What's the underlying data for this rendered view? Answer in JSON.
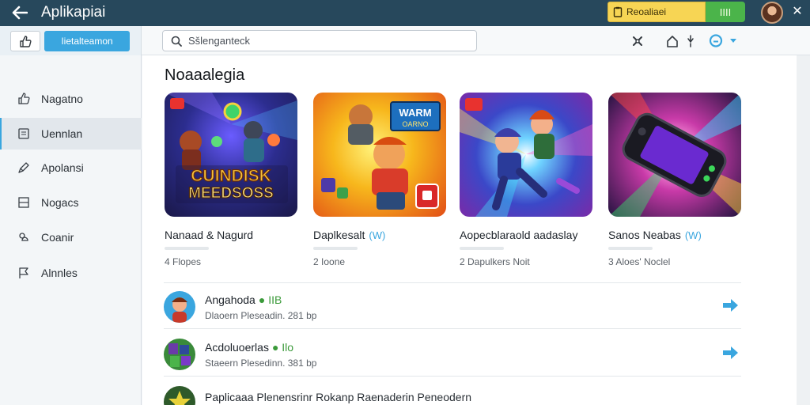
{
  "titlebar": {
    "title": "Aplikapiai",
    "promo_label": "Reoaliaei",
    "promo_count": "IIII"
  },
  "toolbar": {
    "primary_button": "Iietalteamon",
    "search_placeholder": "Sšlenganteck"
  },
  "sidebar": {
    "items": [
      {
        "label": "Nagatno",
        "icon": "thumbs-up-icon"
      },
      {
        "label": "Uennlan",
        "icon": "document-icon",
        "active": true
      },
      {
        "label": "Apolansi",
        "icon": "pen-icon"
      },
      {
        "label": "Nogacs",
        "icon": "book-icon"
      },
      {
        "label": "Coanir",
        "icon": "link-icon"
      },
      {
        "label": "Alnnles",
        "icon": "flag-icon"
      }
    ]
  },
  "main": {
    "section_title": "Noaaalegia",
    "cards": [
      {
        "title": "Nanaad & Nagurd",
        "badge": "",
        "meta": "4 Flopes",
        "art_text": "CUINDISK\nMEEDSOSS"
      },
      {
        "title": "Daplkesalt",
        "badge": "(W)",
        "meta": "2 Ioone",
        "art_text": "WARM\nOARNO"
      },
      {
        "title": "Aopecblaraold aadaslay",
        "badge": "",
        "meta": "2 Dapulkers Noit",
        "art_text": ""
      },
      {
        "title": "Sanos Neabas",
        "badge": "(W)",
        "meta": "3 Aloes' Noclel",
        "art_text": ""
      }
    ],
    "list": [
      {
        "title": "Angahoda",
        "accent": "● IIB",
        "subtitle": "Dlaoern Pleseadin. 281 bp"
      },
      {
        "title": "Acdoluoerlas",
        "accent": "● Ilo",
        "subtitle": "Staeern Plesedinn. 381 bp"
      },
      {
        "title": "Paplicaaa",
        "accent": "Plenensrinr Rokanp Raenaderin Peneodern",
        "subtitle": ""
      }
    ]
  },
  "colors": {
    "titlebar": "#27485c",
    "accent_blue": "#3aa6df",
    "promo_yellow": "#f7d554",
    "promo_green": "#4bb44a"
  }
}
